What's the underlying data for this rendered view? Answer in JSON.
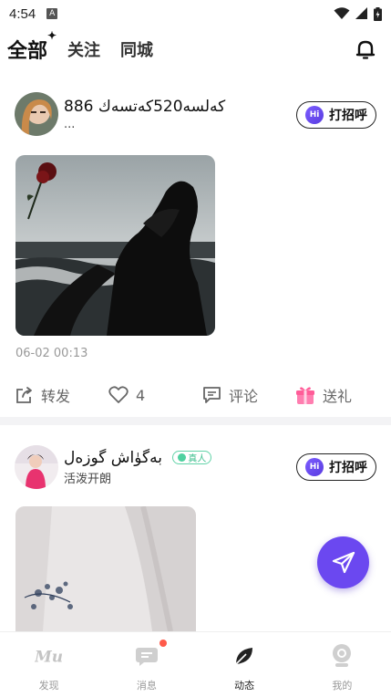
{
  "status_bar": {
    "time": "4:54",
    "notification_icon": "A"
  },
  "top_tabs": [
    {
      "label": "全部",
      "active": true
    },
    {
      "label": "关注",
      "active": false
    },
    {
      "label": "同城",
      "active": false
    }
  ],
  "posts": [
    {
      "username": "كەلسە520كەتسەك 886",
      "subtitle": "...",
      "hi_label": "打招呼",
      "hi_badge": "Hi",
      "timestamp": "06-02 00:13",
      "actions": {
        "share": "转发",
        "like_count": "4",
        "comment": "评论",
        "gift": "送礼"
      }
    },
    {
      "username": "بەگۈاش گوزەل",
      "verified_label": "真人",
      "subtitle": "活泼开朗",
      "hi_label": "打招呼",
      "hi_badge": "Hi"
    }
  ],
  "bottom_nav": [
    {
      "label": "发现",
      "icon": "discover-icon",
      "active": false
    },
    {
      "label": "消息",
      "icon": "message-icon",
      "active": false,
      "badge_dot": true
    },
    {
      "label": "动态",
      "icon": "feed-icon",
      "active": true
    },
    {
      "label": "我的",
      "icon": "profile-icon",
      "active": false
    }
  ],
  "colors": {
    "accent": "#6b48f0",
    "verified": "#3fbf8f",
    "red_dot": "#ff5a4a"
  }
}
